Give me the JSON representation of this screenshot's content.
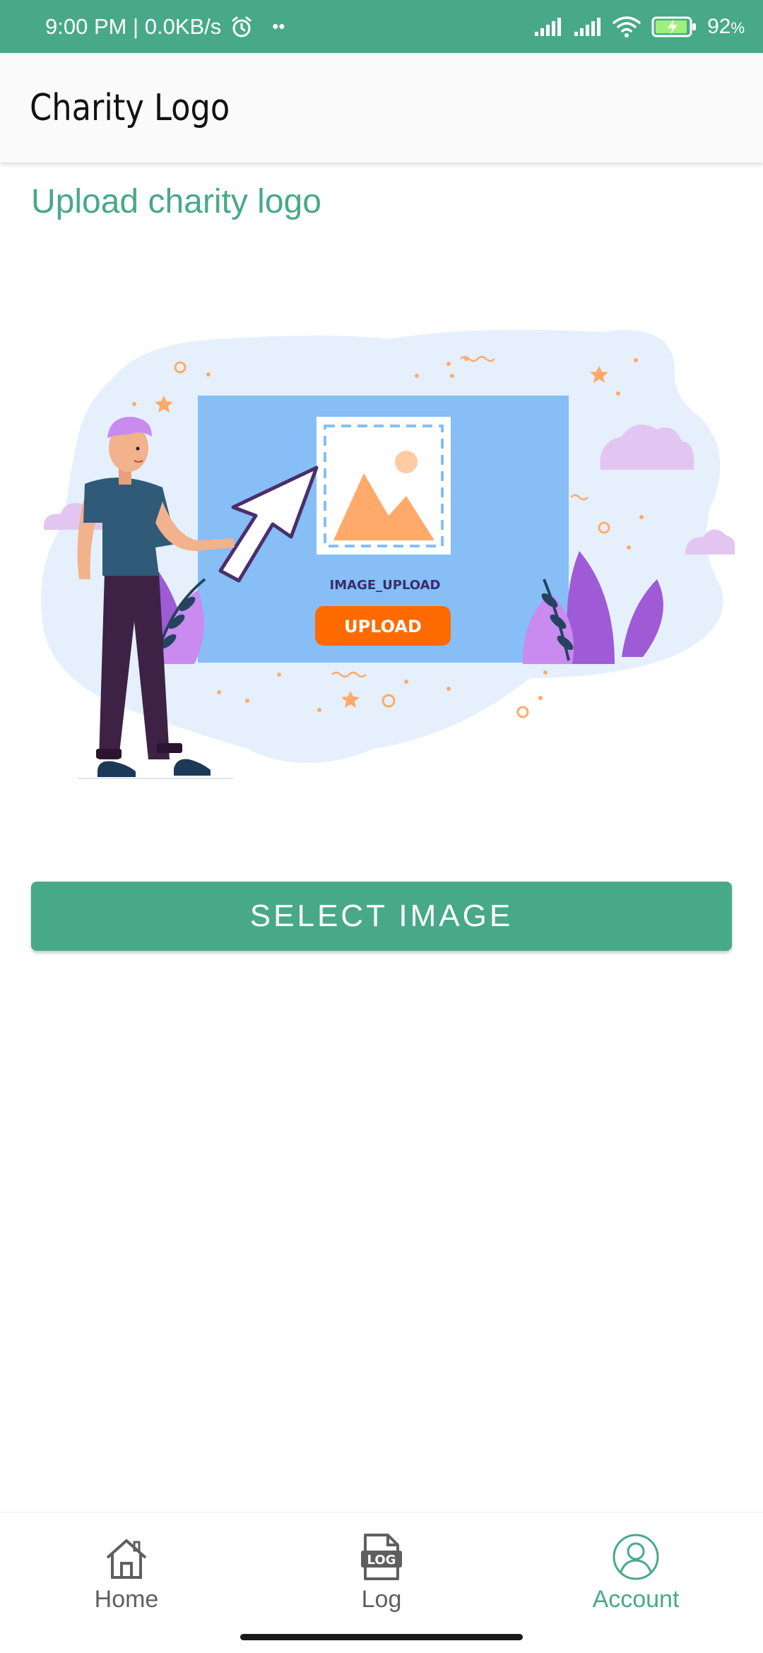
{
  "status_bar": {
    "time_speed": "9:00 PM | 0.0KB/s",
    "dots": "••",
    "battery_percent": "92",
    "battery_suffix": "%",
    "background": "#48A988",
    "icons": [
      "alarm-icon",
      "signal-icon",
      "signal-icon-2",
      "wifi-icon",
      "battery-charging-icon"
    ]
  },
  "app_bar": {
    "title": "Charity Logo"
  },
  "main": {
    "section_title": "Upload charity logo",
    "illustration": {
      "caption": "IMAGE_UPLOAD",
      "button_label": "UPLOAD"
    },
    "select_button_label": "SELECT IMAGE"
  },
  "bottom_nav": {
    "items": [
      {
        "label": "Home",
        "icon": "home-icon",
        "active": false
      },
      {
        "label": "Log",
        "icon": "log-icon",
        "icon_text": "LOG",
        "active": false
      },
      {
        "label": "Account",
        "icon": "account-icon",
        "active": true
      }
    ]
  },
  "colors": {
    "accent": "#48A988",
    "upload_orange": "#FF6A00",
    "panel_blue": "#86BEF5"
  }
}
